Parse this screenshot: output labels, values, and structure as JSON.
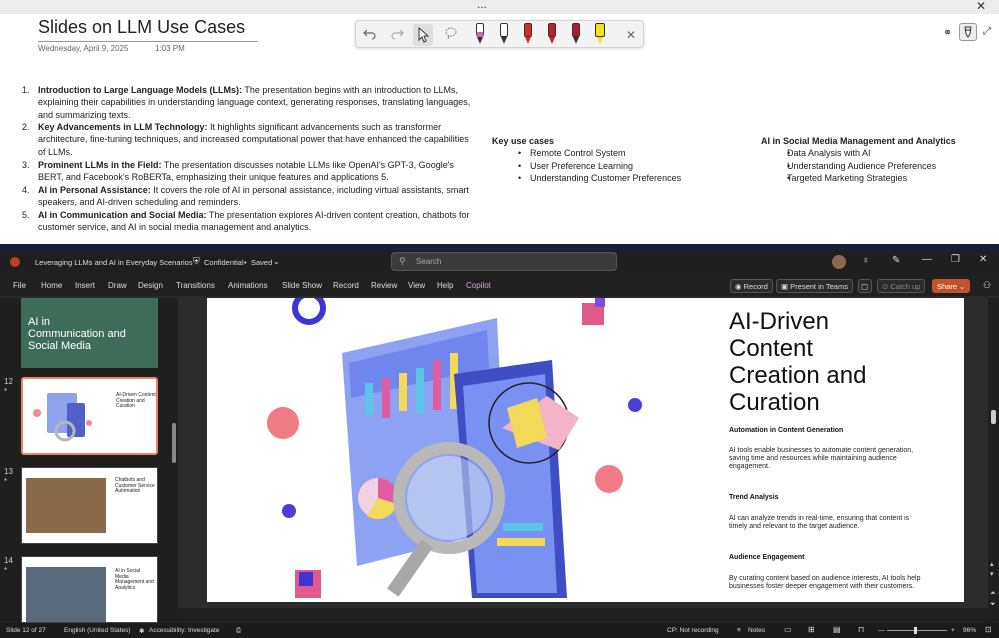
{
  "onenote": {
    "titlebar_dots": "...",
    "close_glyph": "✕",
    "page_title": "Slides on LLM Use Cases",
    "date": "Wednesday, April 9, 2025",
    "time": "1:03 PM",
    "numbered_items": [
      {
        "num": "1.",
        "bold": "Introduction to Large Language Models (LLMs):",
        "text": " The presentation begins with an introduction to LLMs, explaining their capabilities in understanding language context, generating responses, translating languages, and summarizing texts."
      },
      {
        "num": "2.",
        "bold": "Key Advancements in LLM Technology:",
        "text": " It highlights significant advancements such as transformer architecture, fine-tuning techniques, and increased computational power that have enhanced the capabilities of LLMs."
      },
      {
        "num": "3.",
        "bold": "Prominent LLMs in the Field:",
        "text": " The presentation discusses notable LLMs like OpenAI's GPT-3, Google's BERT, and Facebook's RoBERTa, emphasizing their unique features and applications 5."
      },
      {
        "num": "4.",
        "bold": "AI in Personal Assistance:",
        "text": " It covers the role of AI in personal assistance, including virtual assistants, smart speakers, and AI-driven scheduling and reminders."
      },
      {
        "num": "5.",
        "bold": "AI in Communication and Social Media:",
        "text": " The presentation explores AI-driven content creation, chatbots for customer service, and AI in social media management and analytics."
      }
    ],
    "key_use_cases": {
      "heading": "Key use cases",
      "items": [
        "Remote Control System",
        "User Preference Learning",
        "Understanding Customer Preferences"
      ]
    },
    "social_media": {
      "heading": "AI in Social Media Management and Analytics",
      "items": [
        "Data Analysis with AI",
        "Understanding Audience Preferences",
        "Targeted Marketing Strategies"
      ]
    },
    "pen_colors": [
      "#c46bb0",
      "#ffffff",
      "#d92b2b",
      "#c41f2f",
      "#b01c2e",
      "#f2e318"
    ]
  },
  "ppt": {
    "doc_title": "Leveraging LLMs and AI in Everyday Scenarios",
    "sensitivity": "Confidential",
    "save_state": "Saved",
    "search_placeholder": "Search",
    "menu": [
      "File",
      "Home",
      "Insert",
      "Draw",
      "Design",
      "Transitions",
      "Animations",
      "Slide Show",
      "Record",
      "Review",
      "View",
      "Help",
      "Copilot"
    ],
    "record_btn": "Record",
    "present_teams_btn": "Present in Teams",
    "catch_up_btn": "Catch up",
    "share_btn": "Share",
    "thumbs": [
      {
        "num": "",
        "title": "AI in Communication and Social Media"
      },
      {
        "num": "12",
        "title": "AI-Driven Content Creation and Curation"
      },
      {
        "num": "13",
        "title": "Chatbots and Customer Service Automation"
      },
      {
        "num": "14",
        "title": "AI in Social Media Management and Analytics"
      }
    ],
    "slide": {
      "title": "AI-Driven Content Creation and Curation",
      "title_lines": [
        "AI-Driven",
        "Content",
        "Creation and",
        "Curation"
      ],
      "sections": [
        {
          "heading": "Automation in Content Generation",
          "body": "AI tools enable businesses to automate content generation, saving time and resources while maintaining audience engagement."
        },
        {
          "heading": "Trend Analysis",
          "body": "AI can analyze trends in real-time, ensuring that content is timely and relevant to the target audience."
        },
        {
          "heading": "Audience Engagement",
          "body": "By curating content based on audience interests, AI tools help businesses foster deeper engagement with their customers."
        }
      ]
    },
    "status": {
      "slide": "Slide 12 of 27",
      "language": "English (United States)",
      "accessibility": "Accessibility: Investigate",
      "recording": "CP: Not recording",
      "notes": "Notes",
      "zoom": "96%"
    }
  }
}
